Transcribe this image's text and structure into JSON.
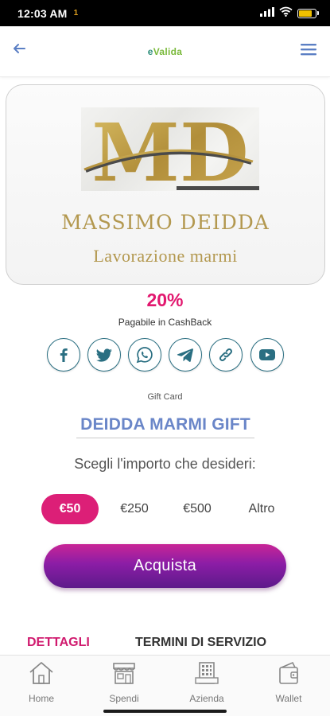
{
  "status_bar": {
    "time": "12:03 AM",
    "notification_icon": "app-notification-icon",
    "signal_icon": "signal-icon",
    "wifi_icon": "wifi-icon",
    "battery_icon": "battery-icon",
    "battery_level": "80"
  },
  "header": {
    "brand_prefix": "e",
    "brand_name": "Valida",
    "back_icon": "arrow-left-icon",
    "menu_icon": "hamburger-menu-icon"
  },
  "merchant": {
    "logo_text": "MD",
    "name": "MASSIMO DEIDDA",
    "subtitle": "Lavorazione marmi"
  },
  "cashback": {
    "percent": "20%",
    "label": "Pagabile in CashBack"
  },
  "share": {
    "icons": [
      "facebook-icon",
      "twitter-icon",
      "whatsapp-icon",
      "telegram-icon",
      "link-icon",
      "youtube-icon"
    ]
  },
  "gift_card": {
    "label": "Gift Card",
    "name": "DEIDDA MARMI GIFT",
    "choose_label": "Scegli l'importo che desideri:",
    "amounts": [
      "€50",
      "€250",
      "€500",
      "Altro"
    ],
    "selected_amount": "€50"
  },
  "buy_button": {
    "label": "Acquista"
  },
  "tabs": {
    "details": "DETTAGLI",
    "terms": "TERMINI DI SERVIZIO"
  },
  "bottom_nav": {
    "items": [
      {
        "label": "Home",
        "icon": "home-icon"
      },
      {
        "label": "Spendi",
        "icon": "store-icon"
      },
      {
        "label": "Azienda",
        "icon": "building-icon"
      },
      {
        "label": "Wallet",
        "icon": "wallet-icon"
      }
    ]
  },
  "colors": {
    "accent_pink": "#dc1f77",
    "gold": "#b3984f",
    "purple": "#8b1da6",
    "gift_blue": "#6a86c8",
    "icon_teal": "#2a6f82"
  }
}
